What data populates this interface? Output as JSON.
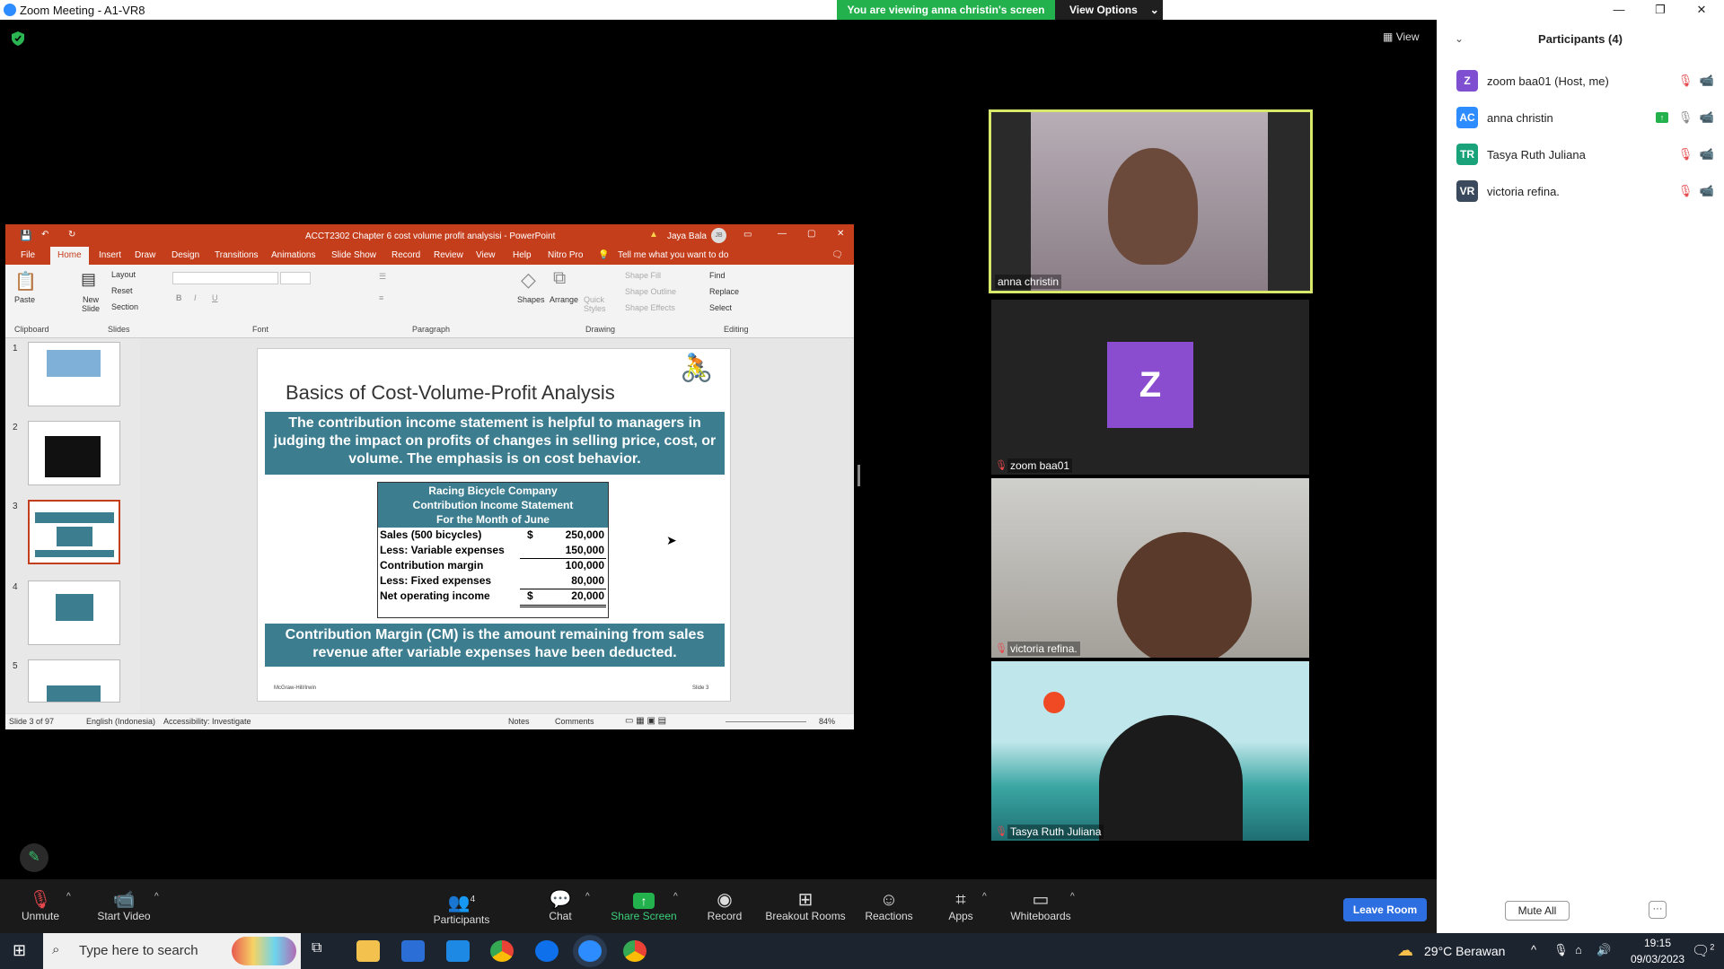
{
  "window": {
    "title": "Zoom Meeting - A1-VR8"
  },
  "banner": {
    "viewing": "You are viewing anna christin's screen",
    "view_options": "View Options"
  },
  "view_label": "View",
  "participants": {
    "header": "Participants (4)",
    "list": [
      {
        "initials": "Z",
        "name": "zoom baa01 (Host, me)",
        "color": "#7e4fd1"
      },
      {
        "initials": "AC",
        "name": "anna christin",
        "color": "#2d8cff"
      },
      {
        "initials": "TR",
        "name": "Tasya Ruth Juliana",
        "color": "#1aa37a"
      },
      {
        "initials": "VR",
        "name": "victoria refina.",
        "color": "#3a4a5c"
      }
    ],
    "mute_all": "Mute All",
    "more": "···"
  },
  "tiles": [
    {
      "name": "anna christin"
    },
    {
      "name": "zoom baa01",
      "initial": "Z"
    },
    {
      "name": "victoria refina."
    },
    {
      "name": "Tasya Ruth Juliana"
    }
  ],
  "ppt": {
    "title": "ACCT2302 Chapter 6  cost volume profit analysisi  -  PowerPoint",
    "user": "Jaya Bala",
    "user_initials": "JB",
    "tabs": [
      "File",
      "Home",
      "Insert",
      "Draw",
      "Design",
      "Transitions",
      "Animations",
      "Slide Show",
      "Record",
      "Review",
      "View",
      "Help",
      "Nitro Pro"
    ],
    "tell_me": "Tell me what you want to do",
    "ribbon": {
      "paste": "Paste",
      "new_slide": "New Slide",
      "layout": "Layout",
      "reset": "Reset",
      "section": "Section",
      "shapes": "Shapes",
      "arrange": "Arrange",
      "quick_styles": "Quick Styles",
      "shape_fill": "Shape Fill",
      "shape_outline": "Shape Outline",
      "shape_effects": "Shape Effects",
      "find": "Find",
      "replace": "Replace",
      "select": "Select",
      "groups": [
        "Clipboard",
        "Slides",
        "Font",
        "Paragraph",
        "Drawing",
        "Editing"
      ]
    },
    "slide_numbers": [
      "1",
      "2",
      "3",
      "4",
      "5"
    ],
    "status": {
      "slide": "Slide 3 of 97",
      "language": "English (Indonesia)",
      "accessibility": "Accessibility: Investigate",
      "notes": "Notes",
      "comments": "Comments",
      "zoom": "84%"
    }
  },
  "slide": {
    "title": "Basics of Cost-Volume-Profit Analysis",
    "band1": "The contribution income statement is helpful to managers in judging the impact on profits of changes in selling price, cost, or volume. The emphasis is on cost behavior.",
    "table_head": [
      "Racing Bicycle Company",
      "Contribution Income Statement",
      "For the Month of June"
    ],
    "rows": [
      {
        "label": "Sales (500 bicycles)",
        "cur": "$",
        "value": "250,000"
      },
      {
        "label": "Less: Variable expenses",
        "cur": "",
        "value": "150,000"
      },
      {
        "label": "Contribution margin",
        "cur": "",
        "value": "100,000"
      },
      {
        "label": "Less: Fixed expenses",
        "cur": "",
        "value": "80,000"
      },
      {
        "label": "Net operating income",
        "cur": "$",
        "value": "20,000"
      }
    ],
    "band2": "Contribution Margin (CM) is the amount remaining from sales revenue after variable expenses have been deducted.",
    "footer_left": "McGraw-Hill/Irwin",
    "footer_right": "Slide 3"
  },
  "toolbar": {
    "unmute": "Unmute",
    "start_video": "Start Video",
    "participants": "Participants",
    "participants_count": "4",
    "chat": "Chat",
    "share": "Share Screen",
    "record": "Record",
    "breakout": "Breakout Rooms",
    "reactions": "Reactions",
    "apps": "Apps",
    "whiteboards": "Whiteboards",
    "leave": "Leave Room"
  },
  "taskbar": {
    "search_placeholder": "Type here to search",
    "weather": "29°C  Berawan",
    "time": "19:15",
    "date": "09/03/2023",
    "notif_count": "2"
  }
}
